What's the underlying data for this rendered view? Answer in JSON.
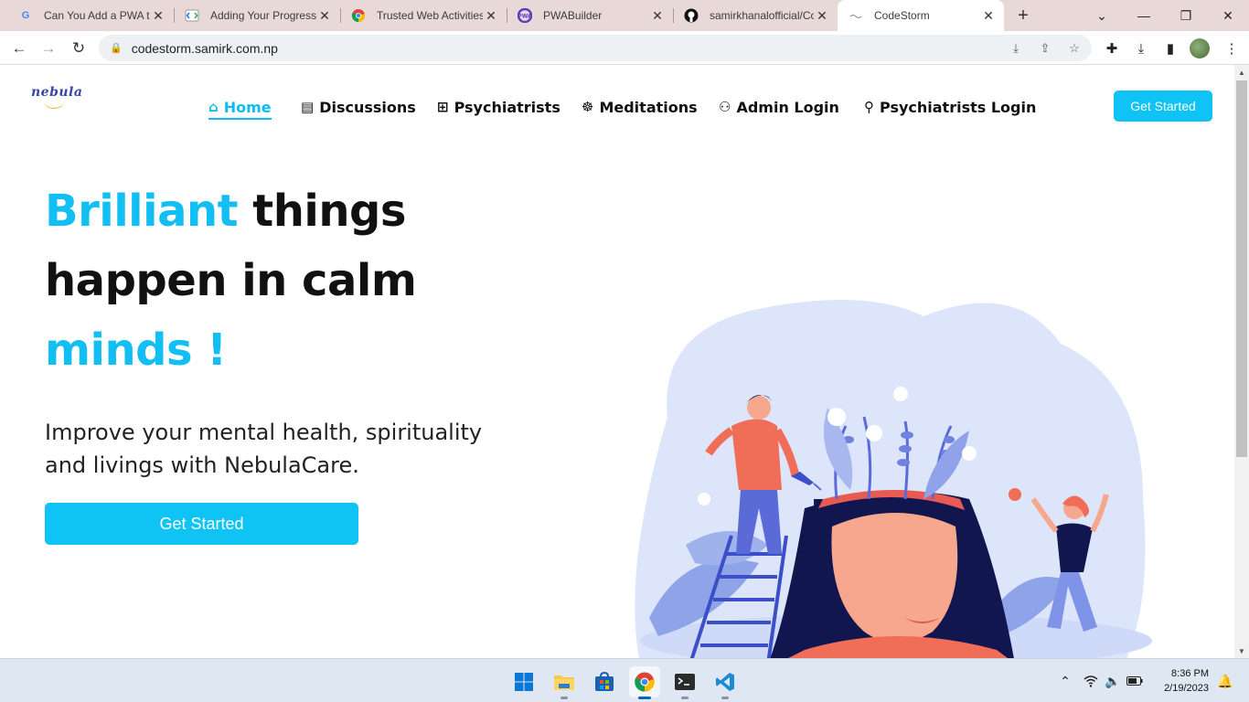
{
  "browser": {
    "tabs": [
      {
        "title": "Can You Add a PWA to",
        "icon": "google-icon"
      },
      {
        "title": "Adding Your Progressi",
        "icon": "web-dev-icon"
      },
      {
        "title": "Trusted Web Activities",
        "icon": "chrome-icon"
      },
      {
        "title": "PWABuilder",
        "icon": "pwabuilder-icon"
      },
      {
        "title": "samirkhanalofficial/Co",
        "icon": "github-icon"
      },
      {
        "title": "CodeStorm",
        "icon": "codestorm-icon",
        "active": true
      }
    ],
    "url": "codestorm.samirk.com.np"
  },
  "site": {
    "logo_text": "nebula",
    "nav": [
      {
        "label": "Home",
        "icon": "home-icon",
        "active": true
      },
      {
        "label": "Discussions",
        "icon": "document-icon"
      },
      {
        "label": "Psychiatrists",
        "icon": "medical-kit-icon"
      },
      {
        "label": "Meditations",
        "icon": "meditation-icon"
      },
      {
        "label": "Admin Login",
        "icon": "user-edit-icon"
      },
      {
        "label": "Psychiatrists Login",
        "icon": "location-pin-icon"
      }
    ],
    "nav_cta": "Get Started",
    "hero": {
      "line1_accent": "Brilliant",
      "line1_rest": " things",
      "line2": "happen in calm",
      "line3_accent": "minds !",
      "subtitle": "Improve your mental health, spirituality and livings with NebulaCare.",
      "cta": "Get Started"
    }
  },
  "colors": {
    "accent": "#13bff2",
    "button": "#0fc3f5",
    "text": "#111111"
  },
  "taskbar": {
    "apps": [
      "windows-start-icon",
      "file-explorer-icon",
      "microsoft-store-icon",
      "chrome-icon",
      "terminal-icon",
      "vscode-icon"
    ],
    "time": "8:36 PM",
    "date": "2/19/2023"
  }
}
